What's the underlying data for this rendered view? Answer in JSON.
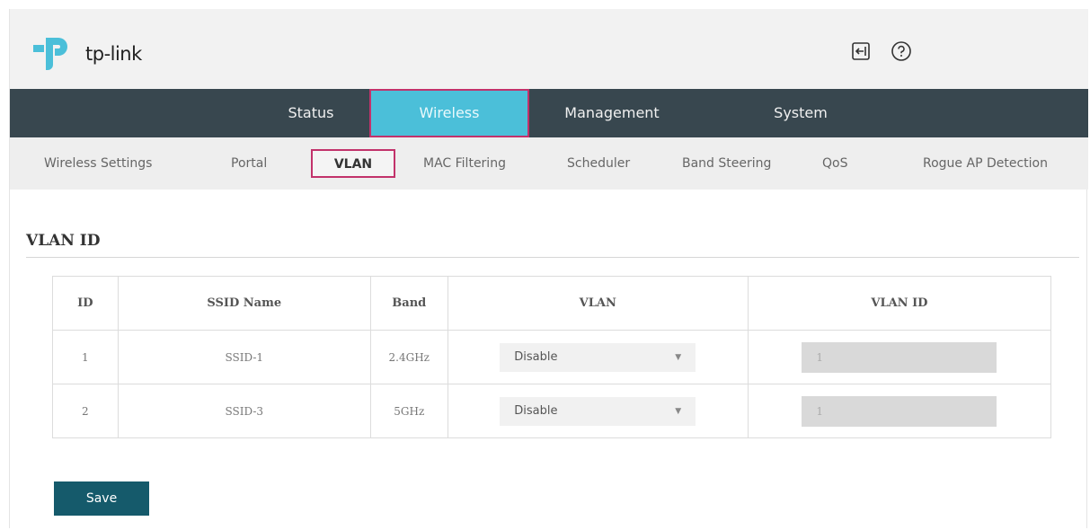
{
  "brand": {
    "name": "tp-link",
    "color": "#4bbfd9"
  },
  "header": {
    "icons": [
      "logout-icon",
      "help-icon"
    ]
  },
  "main_nav": {
    "tabs": [
      {
        "label": "Status"
      },
      {
        "label": "Wireless",
        "active": true
      },
      {
        "label": "Management"
      },
      {
        "label": "System"
      }
    ]
  },
  "sub_nav": {
    "tabs": [
      {
        "label": "Wireless Settings"
      },
      {
        "label": "Portal"
      },
      {
        "label": "VLAN",
        "active": true
      },
      {
        "label": "MAC Filtering"
      },
      {
        "label": "Scheduler"
      },
      {
        "label": "Band Steering"
      },
      {
        "label": "QoS"
      },
      {
        "label": "Rogue AP Detection"
      }
    ]
  },
  "section": {
    "title": "VLAN ID"
  },
  "table": {
    "headers": {
      "id": "ID",
      "ssid": "SSID Name",
      "band": "Band",
      "vlan": "VLAN",
      "vlan_id": "VLAN ID"
    },
    "rows": [
      {
        "id": "1",
        "ssid": "SSID-1",
        "band": "2.4GHz",
        "vlan": "Disable",
        "vlan_id": "1"
      },
      {
        "id": "2",
        "ssid": "SSID-3",
        "band": "5GHz",
        "vlan": "Disable",
        "vlan_id": "1"
      }
    ]
  },
  "actions": {
    "save_label": "Save"
  },
  "colors": {
    "nav_bg": "#38474f",
    "active_tab": "#4bbfd9",
    "highlight_border": "#c2326b",
    "save_button": "#155a6b"
  }
}
